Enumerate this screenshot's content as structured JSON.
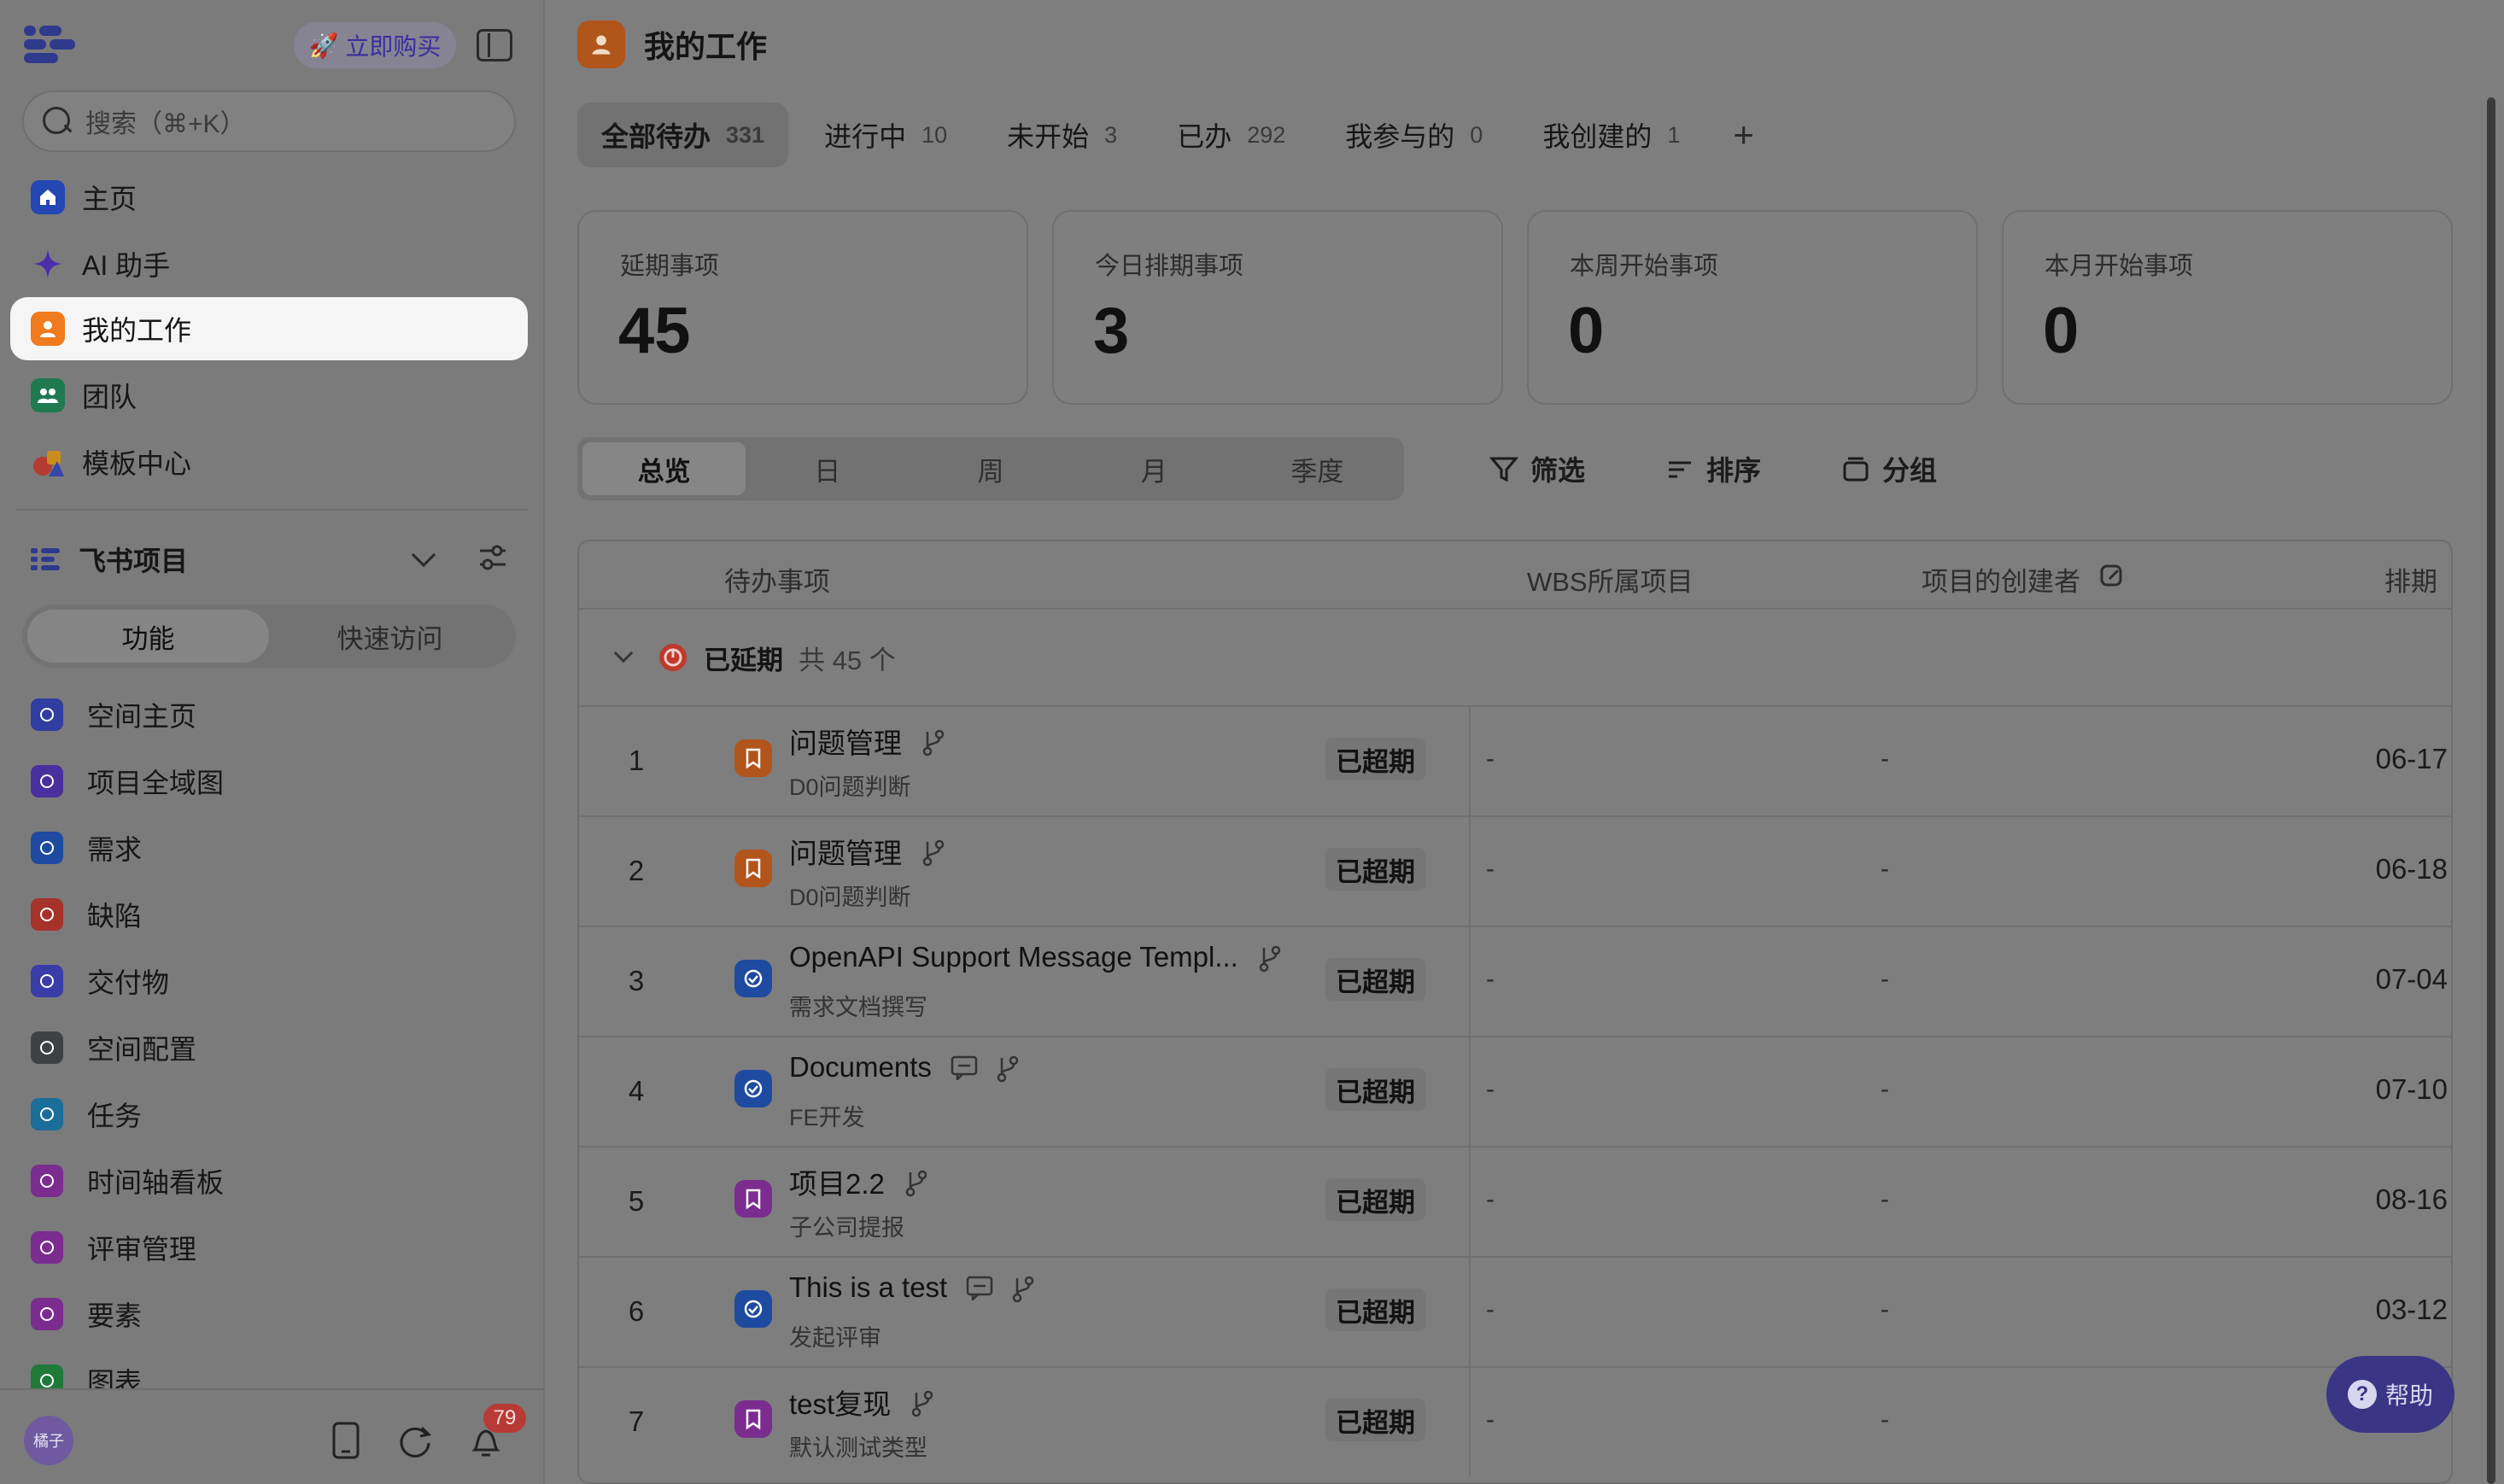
{
  "colors": {
    "active_nav_bg": "#f5f5f5",
    "accent_orange": "#b1551b",
    "overdue_red": "#c0392b",
    "help_button": "#3b3585"
  },
  "sidebar": {
    "buy_label": "立即购买",
    "search_placeholder": "搜索（⌘+K）",
    "nav": [
      {
        "label": "主页",
        "icon": "home-icon"
      },
      {
        "label": "AI 助手",
        "icon": "sparkle-icon"
      },
      {
        "label": "我的工作",
        "icon": "person-icon"
      },
      {
        "label": "团队",
        "icon": "team-icon"
      },
      {
        "label": "模板中心",
        "icon": "template-icon"
      }
    ],
    "section_title": "飞书项目",
    "segments": [
      "功能",
      "快速访问"
    ],
    "functions": [
      {
        "label": "空间主页",
        "color": "#2f3ea0"
      },
      {
        "label": "项目全域图",
        "color": "#4a2f9e"
      },
      {
        "label": "需求",
        "color": "#1e4aa0"
      },
      {
        "label": "缺陷",
        "color": "#a5332a"
      },
      {
        "label": "交付物",
        "color": "#3a3ca8"
      },
      {
        "label": "空间配置",
        "color": "#3f4044"
      },
      {
        "label": "任务",
        "color": "#1b6e99"
      },
      {
        "label": "时间轴看板",
        "color": "#7a2d8f"
      },
      {
        "label": "评审管理",
        "color": "#7a2d8f"
      },
      {
        "label": "要素",
        "color": "#7a2d8f"
      },
      {
        "label": "图表",
        "color": "#1f7a3a"
      }
    ],
    "avatar_text": "橘子",
    "notification_count": "79"
  },
  "header": {
    "title": "我的工作"
  },
  "tabs": [
    {
      "label": "全部待办",
      "count": "331"
    },
    {
      "label": "进行中",
      "count": "10"
    },
    {
      "label": "未开始",
      "count": "3"
    },
    {
      "label": "已办",
      "count": "292"
    },
    {
      "label": "我参与的",
      "count": "0"
    },
    {
      "label": "我创建的",
      "count": "1"
    }
  ],
  "add_tab_label": "+",
  "stats": [
    {
      "label": "延期事项",
      "value": "45"
    },
    {
      "label": "今日排期事项",
      "value": "3"
    },
    {
      "label": "本周开始事项",
      "value": "0"
    },
    {
      "label": "本月开始事项",
      "value": "0"
    }
  ],
  "periods": [
    "总览",
    "日",
    "周",
    "月",
    "季度"
  ],
  "tools": {
    "filter": "筛选",
    "sort": "排序",
    "group": "分组"
  },
  "table": {
    "columns": [
      "待办事项",
      "WBS所属项目",
      "项目的创建者",
      "排期"
    ],
    "group": {
      "name": "已延期",
      "count_text": "共 45 个"
    },
    "rows": [
      {
        "num": "1",
        "name": "问题管理",
        "sub": "D0问题判断",
        "status": "已超期",
        "wbs": "-",
        "creator": "-",
        "date": "06-17",
        "icon_color": "#b1551b",
        "icon": "bookmark-icon",
        "comment": false
      },
      {
        "num": "2",
        "name": "问题管理",
        "sub": "D0问题判断",
        "status": "已超期",
        "wbs": "-",
        "creator": "-",
        "date": "06-18",
        "icon_color": "#b1551b",
        "icon": "bookmark-icon",
        "comment": false
      },
      {
        "num": "3",
        "name": "OpenAPI Support Message Templ...",
        "sub": "需求文档撰写",
        "status": "已超期",
        "wbs": "-",
        "creator": "-",
        "date": "07-04",
        "icon_color": "#1e4aa0",
        "icon": "check-circle-icon",
        "comment": false
      },
      {
        "num": "4",
        "name": "Documents",
        "sub": "FE开发",
        "status": "已超期",
        "wbs": "-",
        "creator": "-",
        "date": "07-10",
        "icon_color": "#1e4aa0",
        "icon": "check-circle-icon",
        "comment": true
      },
      {
        "num": "5",
        "name": "项目2.2",
        "sub": "子公司提报",
        "status": "已超期",
        "wbs": "-",
        "creator": "-",
        "date": "08-16",
        "icon_color": "#7a2d8f",
        "icon": "bookmark-icon",
        "comment": false
      },
      {
        "num": "6",
        "name": "This is a test",
        "sub": "发起评审",
        "status": "已超期",
        "wbs": "-",
        "creator": "-",
        "date": "03-12",
        "icon_color": "#1e4aa0",
        "icon": "check-circle-icon",
        "comment": true
      },
      {
        "num": "7",
        "name": "test复现",
        "sub": "默认测试类型",
        "status": "已超期",
        "wbs": "-",
        "creator": "-",
        "date": "",
        "icon_color": "#7a2d8f",
        "icon": "bookmark-icon",
        "comment": false
      }
    ]
  },
  "help_label": "帮助"
}
